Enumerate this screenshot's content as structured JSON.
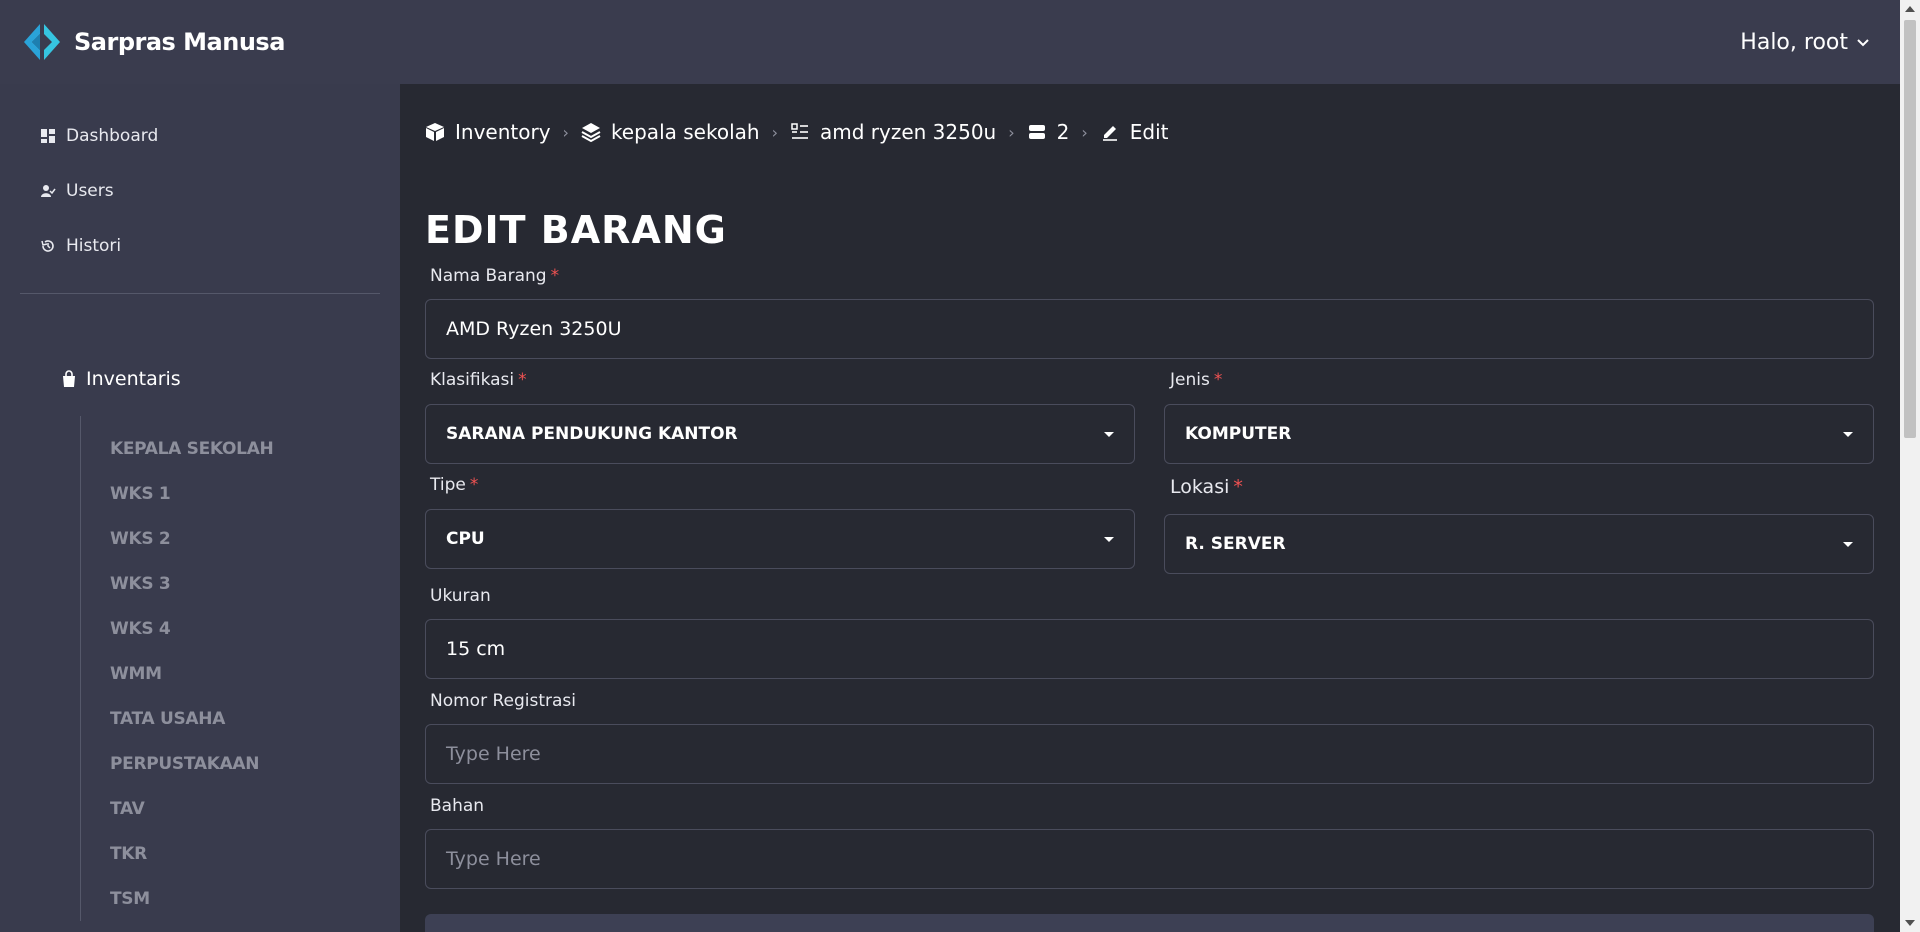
{
  "app": {
    "brand": "Sarpras Manusa",
    "user_greeting": "Halo, root"
  },
  "sidebar": {
    "nav": [
      {
        "label": "Dashboard",
        "icon": "dashboard-icon"
      },
      {
        "label": "Users",
        "icon": "user-check-icon"
      },
      {
        "label": "Histori",
        "icon": "history-icon"
      }
    ],
    "inventory_title": "Inventaris",
    "inventory_items": [
      "KEPALA SEKOLAH",
      "WKS 1",
      "WKS 2",
      "WKS 3",
      "WKS 4",
      "WMM",
      "TATA USAHA",
      "PERPUSTAKAAN",
      "TAV",
      "TKR",
      "TSM"
    ]
  },
  "breadcrumb": [
    {
      "label": "Inventory",
      "icon": "box-icon"
    },
    {
      "label": "kepala sekolah",
      "icon": "layers-icon"
    },
    {
      "label": "amd ryzen 3250u",
      "icon": "list-icon"
    },
    {
      "label": "2",
      "icon": "server-icon"
    },
    {
      "label": "Edit",
      "icon": "edit-icon"
    }
  ],
  "form": {
    "title": "EDIT BARANG",
    "required_mark": "*",
    "nama_barang": {
      "label": "Nama Barang",
      "value": "AMD Ryzen 3250U"
    },
    "klasifikasi": {
      "label": "Klasifikasi",
      "value": "SARANA PENDUKUNG KANTOR"
    },
    "jenis": {
      "label": "Jenis",
      "value": "KOMPUTER"
    },
    "tipe": {
      "label": "Tipe",
      "value": "CPU"
    },
    "lokasi": {
      "label": "Lokasi",
      "value": "R. SERVER"
    },
    "ukuran": {
      "label": "Ukuran",
      "value": "15 cm"
    },
    "nomor_registrasi": {
      "label": "Nomor Registrasi",
      "placeholder": "Type Here"
    },
    "bahan": {
      "label": "Bahan",
      "placeholder": "Type Here"
    }
  },
  "colors": {
    "accent_logo_blue": "#29a9d6",
    "accent_logo_cyan": "#36c5e0",
    "required": "#f05252"
  }
}
